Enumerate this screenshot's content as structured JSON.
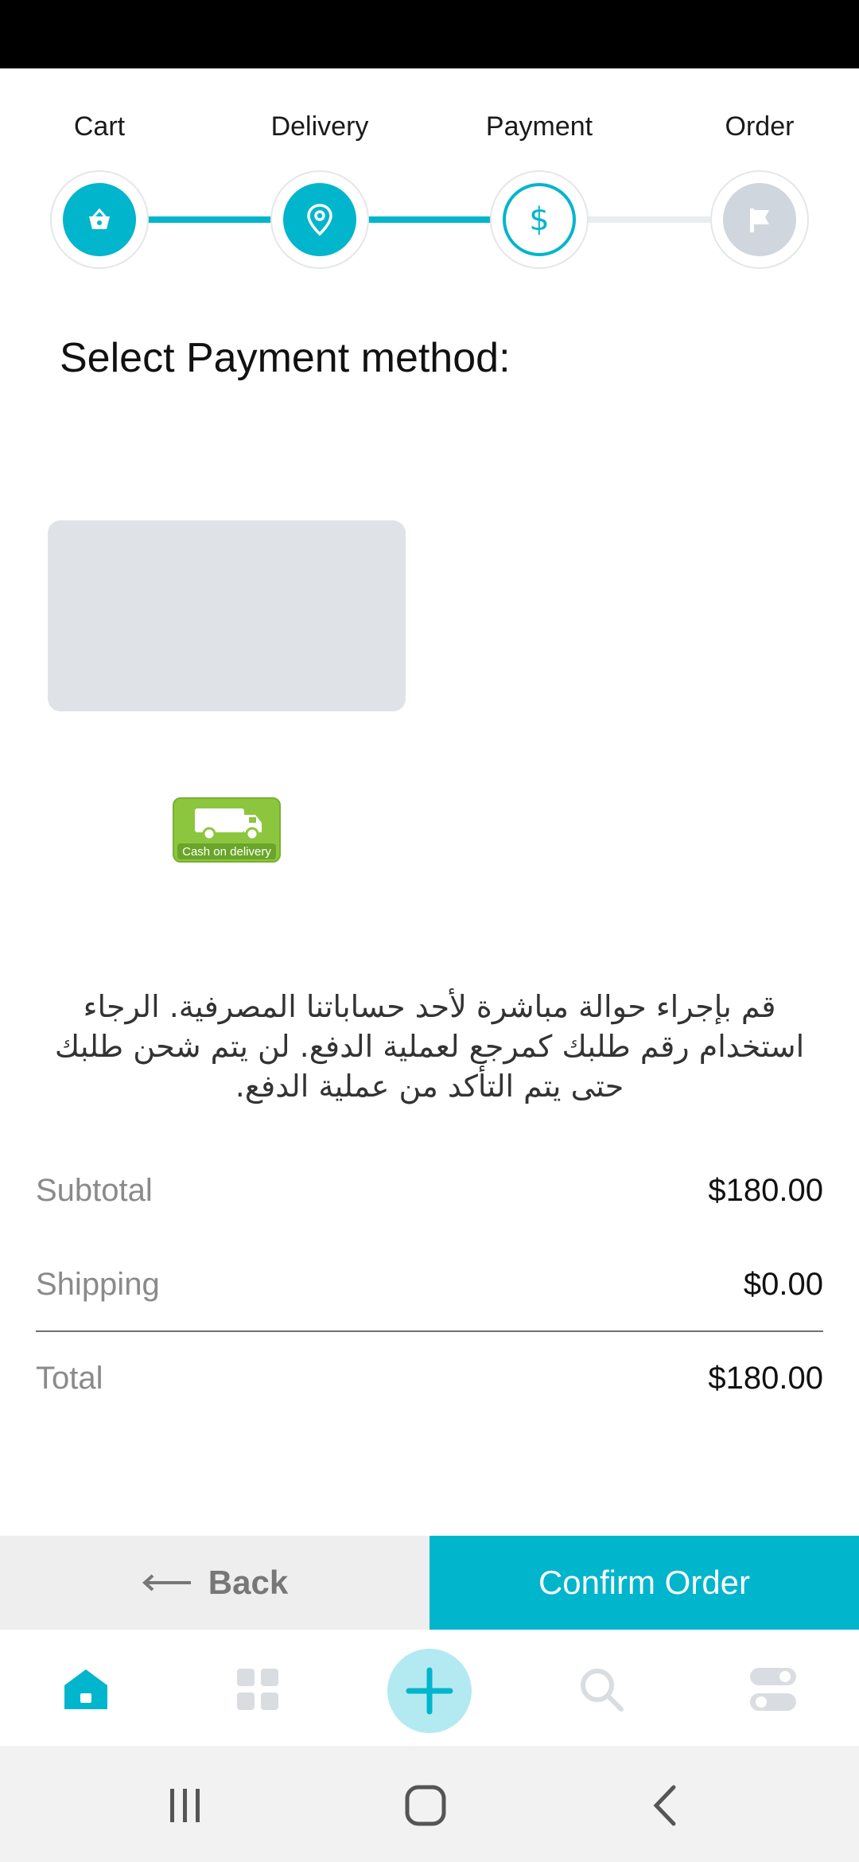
{
  "stepper": {
    "steps": [
      {
        "label": "Cart",
        "state": "done",
        "icon": "basket-icon"
      },
      {
        "label": "Delivery",
        "state": "done",
        "icon": "location-pin-icon"
      },
      {
        "label": "Payment",
        "state": "current",
        "icon": "dollar-icon",
        "glyph": "$"
      },
      {
        "label": "Order",
        "state": "todo",
        "icon": "flag-icon"
      }
    ]
  },
  "payment": {
    "title": "Select Payment method:",
    "methods": [
      {
        "name": "card-placeholder"
      },
      {
        "name": "cash-on-delivery",
        "badge_text": "Cash on delivery"
      }
    ],
    "instructions": "قم بإجراء حوالة مباشرة لأحد حساباتنا المصرفية. الرجاء استخدام رقم طلبك كمرجع لعملية الدفع. لن يتم شحن طلبك حتى يتم التأكد من عملية الدفع."
  },
  "summary": {
    "subtotal_label": "Subtotal",
    "subtotal_value": "$180.00",
    "shipping_label": "Shipping",
    "shipping_value": "$0.00",
    "total_label": "Total",
    "total_value": "$180.00"
  },
  "actions": {
    "back_label": "Back",
    "confirm_label": "Confirm Order"
  },
  "bottom_nav": {
    "items": [
      "home-icon",
      "grid-icon",
      "add-icon",
      "search-icon",
      "toggles-icon"
    ],
    "active": "home-icon"
  },
  "system_nav": [
    "recent-apps-icon",
    "home-button-icon",
    "back-icon"
  ],
  "colors": {
    "accent": "#00b5cc",
    "accent_light": "#b3eaf2",
    "inactive": "#cfd6de",
    "cod_green": "#8cc63f"
  }
}
